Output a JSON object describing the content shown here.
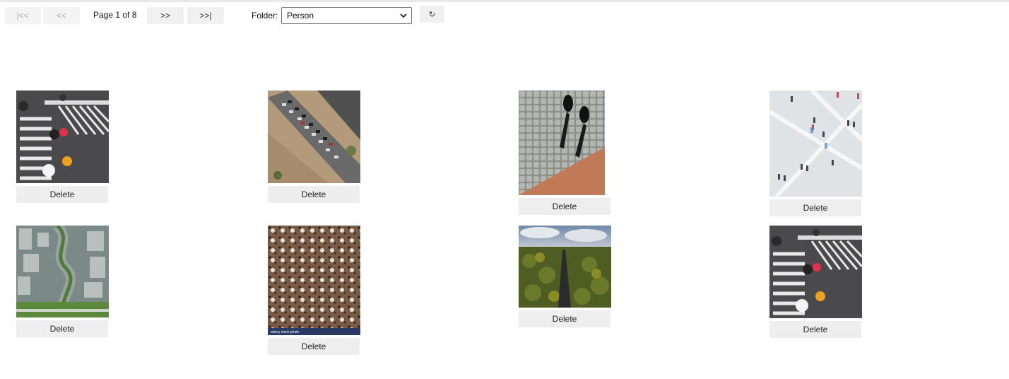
{
  "toolbar": {
    "first_label": "|<<",
    "prev_label": "<<",
    "page_info": "Page 1 of 8",
    "next_label": ">>",
    "last_label": ">>|",
    "folder_label": "Folder:",
    "folder_selected": "Person",
    "refresh_icon": "refresh-icon",
    "refresh_glyph": "↻"
  },
  "gallery": {
    "delete_label": "Delete",
    "images": [
      {
        "subject": "crosswalk-umbrellas"
      },
      {
        "subject": "traffic-jam-road"
      },
      {
        "subject": "cobblestone-shadows"
      },
      {
        "subject": "crowd-blurred-square"
      },
      {
        "subject": "city-highway-aerial"
      },
      {
        "subject": "cafe-crowd-aerial",
        "watermark": "alamy stock photo"
      },
      {
        "subject": "forest-road-aerial"
      },
      {
        "subject": "crosswalk-umbrellas"
      }
    ]
  }
}
